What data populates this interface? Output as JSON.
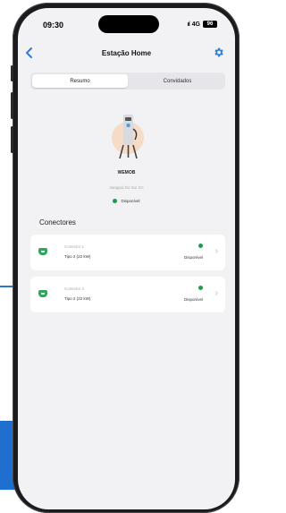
{
  "status_bar": {
    "time": "09:30",
    "signal": "ııl",
    "network": "4G",
    "battery": "96"
  },
  "nav": {
    "title": "Estação Home"
  },
  "tabs": [
    {
      "label": "Resumo",
      "active": true
    },
    {
      "label": "Convidados",
      "active": false
    }
  ],
  "station": {
    "name": "WEMOB",
    "address": "Jaraguá Do Sul SC",
    "status": "Disponível",
    "status_color": "#1f9a4a"
  },
  "connectors_title": "Conectores",
  "connectors": [
    {
      "label": "Conector 1",
      "type": "Tipo 2 (22 kW)",
      "status": "Disponível"
    },
    {
      "label": "Conector 2",
      "type": "Tipo 2 (22 kW)",
      "status": "Disponível"
    }
  ],
  "colors": {
    "accent": "#2f7bd6",
    "available": "#1f9a4a"
  }
}
